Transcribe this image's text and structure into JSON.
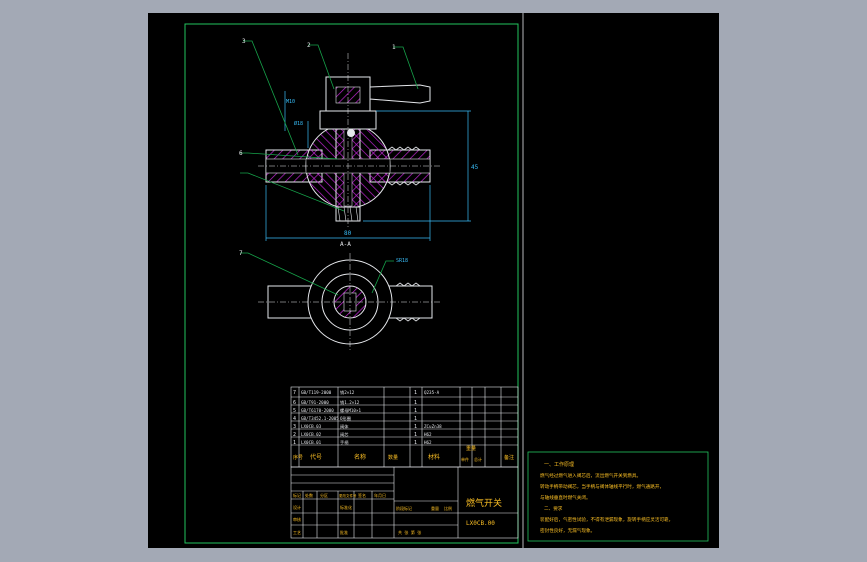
{
  "colors": {
    "background": "#a3a9b5",
    "sheet": "#000000",
    "frame": "#22c55e",
    "outline": "#e5e7eb",
    "hatch": "#c026d3",
    "dimension": "#38bdf8",
    "leader": "#16a34a",
    "text": "#fbbf24",
    "text_alt": "#e5e7eb"
  },
  "drawing": {
    "leaders": {
      "l1": "1",
      "l2": "2",
      "l3": "3",
      "l6": "6",
      "l7": "7"
    },
    "dims": {
      "d_top": "M10",
      "d_left": "Ø18",
      "d_bottom": "80",
      "d_right": "45",
      "section": "A-A",
      "d_plan": "SR18"
    }
  },
  "bom": {
    "rows": [
      {
        "no": "7",
        "code": "GB/T119-2000",
        "name": "销2×12",
        "qty": "1",
        "material": "Q235-A"
      },
      {
        "no": "6",
        "code": "GB/T91-2000",
        "name": "销1.2×12",
        "qty": "1",
        "material": ""
      },
      {
        "no": "5",
        "code": "GB/T6170-2000",
        "name": "螺母M10×1",
        "qty": "1",
        "material": ""
      },
      {
        "no": "4",
        "code": "GB/T3452.1-2005",
        "name": "O形圈",
        "qty": "1",
        "material": ""
      },
      {
        "no": "3",
        "code": "LX0CB.03",
        "name": "阀体",
        "qty": "1",
        "material": "ZCuZn38"
      },
      {
        "no": "2",
        "code": "LX0CB.02",
        "name": "阀芯",
        "qty": "1",
        "material": "H62"
      },
      {
        "no": "1",
        "code": "LX0CB.01",
        "name": "手柄",
        "qty": "1",
        "material": "H62"
      }
    ],
    "header": {
      "no": "序号",
      "code": "代号",
      "name": "名称",
      "qty": "数量",
      "material": "材料",
      "unit_w": "单件",
      "total_w": "总计",
      "weight": "重量",
      "note": "备注"
    }
  },
  "title_block": {
    "title": "燃气开关",
    "drawing_no": "LX0CB.00",
    "labels": {
      "mark": "标记",
      "count": "处数",
      "zone": "分区",
      "doc": "更改文件号",
      "sign": "签名",
      "date": "年月日",
      "design": "设计",
      "std": "标准化",
      "review": "审核",
      "process": "工艺",
      "approve": "批准",
      "stage": "阶段标记",
      "weight": "重量",
      "scale": "比例",
      "sheets": "共 张 第 张"
    }
  },
  "notes": {
    "heading": "一、工作原理",
    "lines": [
      "燃气经过燃气进入阀芯后，流出燃气开关到燃具。",
      "转动手柄带动阀芯，当手柄与阀体轴线平行时，燃气通路开，",
      "与轴线垂直时燃气关闭。",
      "二、要求",
      "装配好后，气密性试验，不得有泄漏现象，旋转手柄应灵活可靠，",
      "密封性良好，无漏气现象。"
    ]
  }
}
